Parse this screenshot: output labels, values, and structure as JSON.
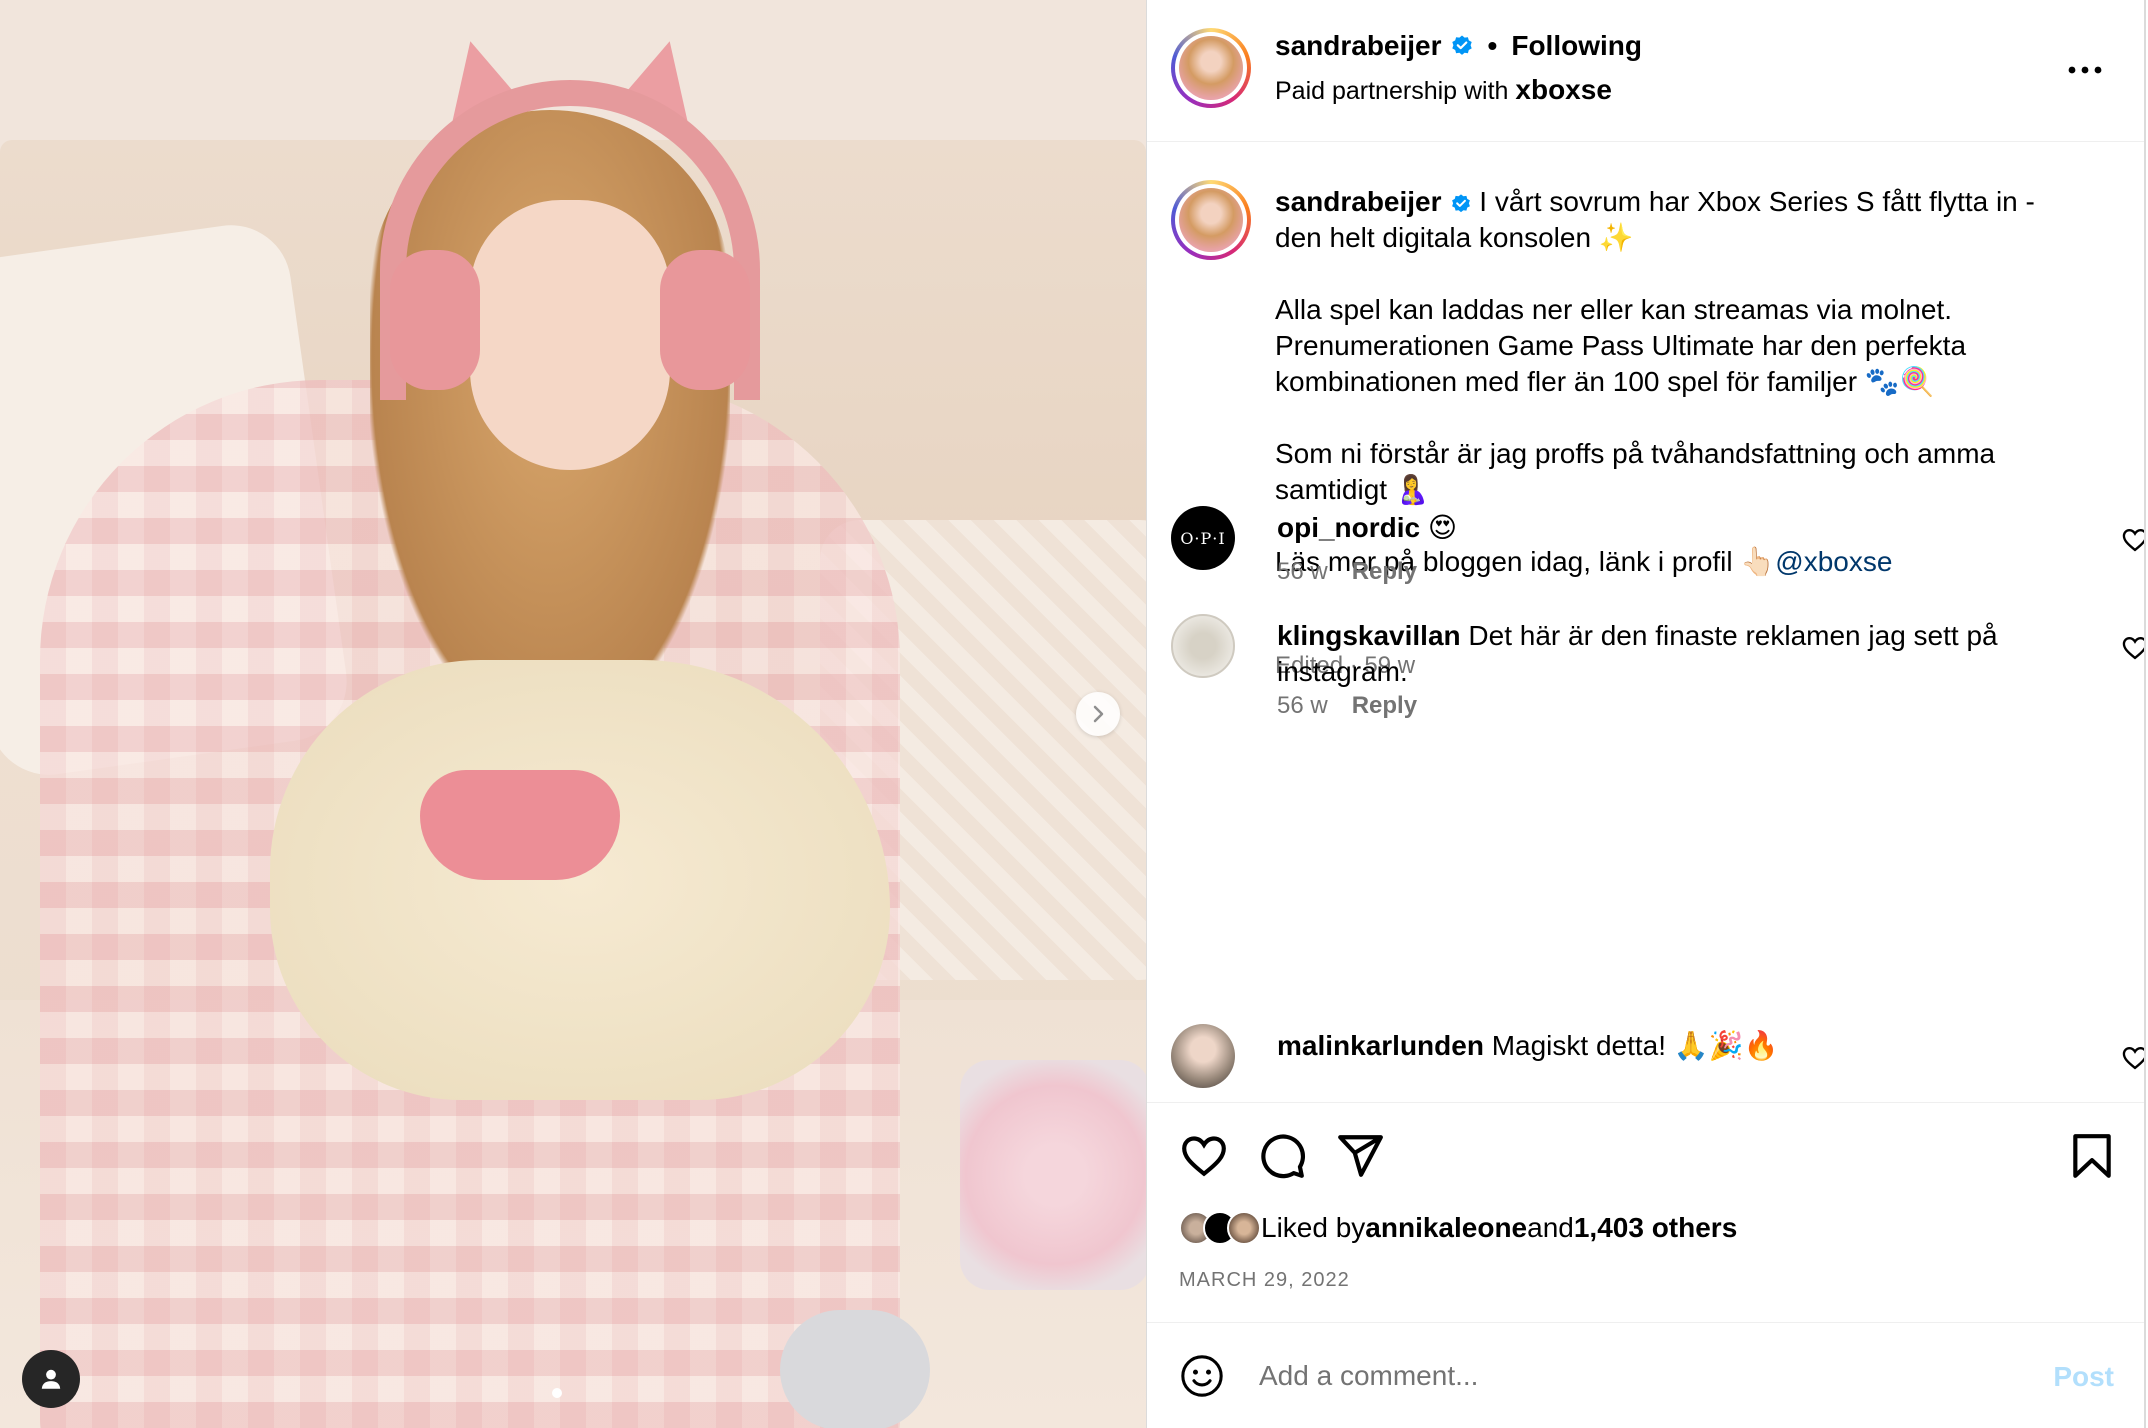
{
  "header": {
    "username": "sandrabeijer",
    "separator": "•",
    "follow_status": "Following",
    "partnership_prefix": "Paid partnership with ",
    "partner": "xboxse"
  },
  "caption": {
    "username": "sandrabeijer",
    "line1": " I vårt sovrum har Xbox Series S fått flytta in - den helt digitala konsolen ✨",
    "para2": "Alla spel kan laddas ner eller kan streamas via molnet. Prenumerationen Game Pass Ultimate har den perfekta kombinationen med fler än 100 spel för familjer 🐾🍭",
    "para3": "Som ni förstår är jag proffs på tvåhandsfattning och amma samtidigt 🤱",
    "para4_text": "Läs mer på bloggen idag, länk i profil 👆🏻",
    "para4_mention": "@xboxse",
    "meta": "Edited · 59 w"
  },
  "comments": [
    {
      "username": "opi_nordic",
      "text": " 😍",
      "time": "56 w",
      "reply": "Reply",
      "avatar_text": "O·P·I"
    },
    {
      "username": "klingskavillan",
      "text": " Det här är den finaste reklamen jag sett på instagram.",
      "time": "56 w",
      "reply": "Reply"
    },
    {
      "username": "malinkarlunden",
      "text": " Magiskt detta! 🙏🎉🔥"
    }
  ],
  "likes": {
    "prefix": "Liked by ",
    "first_user": "annikaleone",
    "middle": " and ",
    "others": "1,403 others"
  },
  "date": "MARCH 29, 2022",
  "add_comment": {
    "placeholder": "Add a comment...",
    "post_label": "Post"
  },
  "colors": {
    "verified": "#0095f6",
    "mention": "#00376b",
    "post_disabled": "#b2dffc",
    "muted": "#737373"
  },
  "icons": {
    "next": "chevron-right-icon",
    "tag": "user-icon",
    "more": "more-horizontal-icon",
    "like": "heart-icon",
    "comment": "comment-icon",
    "share": "send-icon",
    "save": "bookmark-icon",
    "emoji": "emoji-icon"
  }
}
